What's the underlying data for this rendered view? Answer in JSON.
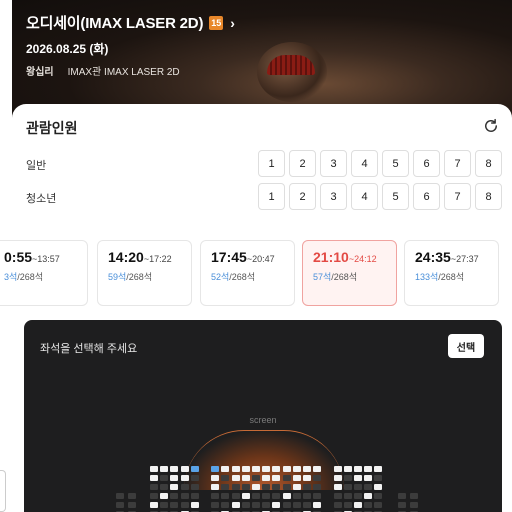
{
  "header": {
    "movie_title": "오디세이(IMAX LASER 2D)",
    "age_rating": "15",
    "date": "2026.08.25 (화)",
    "theater": "왕십리",
    "screen": "IMAX관 IMAX LASER 2D"
  },
  "people": {
    "title": "관람인원",
    "rows": [
      {
        "label": "일반",
        "options": [
          "1",
          "2",
          "3",
          "4",
          "5",
          "6",
          "7",
          "8"
        ]
      },
      {
        "label": "청소년",
        "options": [
          "1",
          "2",
          "3",
          "4",
          "5",
          "6",
          "7",
          "8"
        ]
      }
    ]
  },
  "showtimes": [
    {
      "start": "0:55",
      "end": "~13:57",
      "avail": "3석",
      "total": "/268석",
      "selected": false
    },
    {
      "start": "14:20",
      "end": "~17:22",
      "avail": "59석",
      "total": "/268석",
      "selected": false
    },
    {
      "start": "17:45",
      "end": "~20:47",
      "avail": "52석",
      "total": "/268석",
      "selected": false
    },
    {
      "start": "21:10",
      "end": "~24:12",
      "avail": "57석",
      "total": "/268석",
      "selected": true
    },
    {
      "start": "24:35",
      "end": "~27:37",
      "avail": "133석",
      "total": "/268석",
      "selected": false
    }
  ],
  "seat_map": {
    "prompt": "좌석을 선택해 주세요",
    "select_button": "선택",
    "screen_label": "screen"
  },
  "colors": {
    "accent_red": "#e34a44",
    "seat_available": "#f2f2f2",
    "seat_taken": "#3c3c3c",
    "seat_selected": "#5aa2e6"
  }
}
